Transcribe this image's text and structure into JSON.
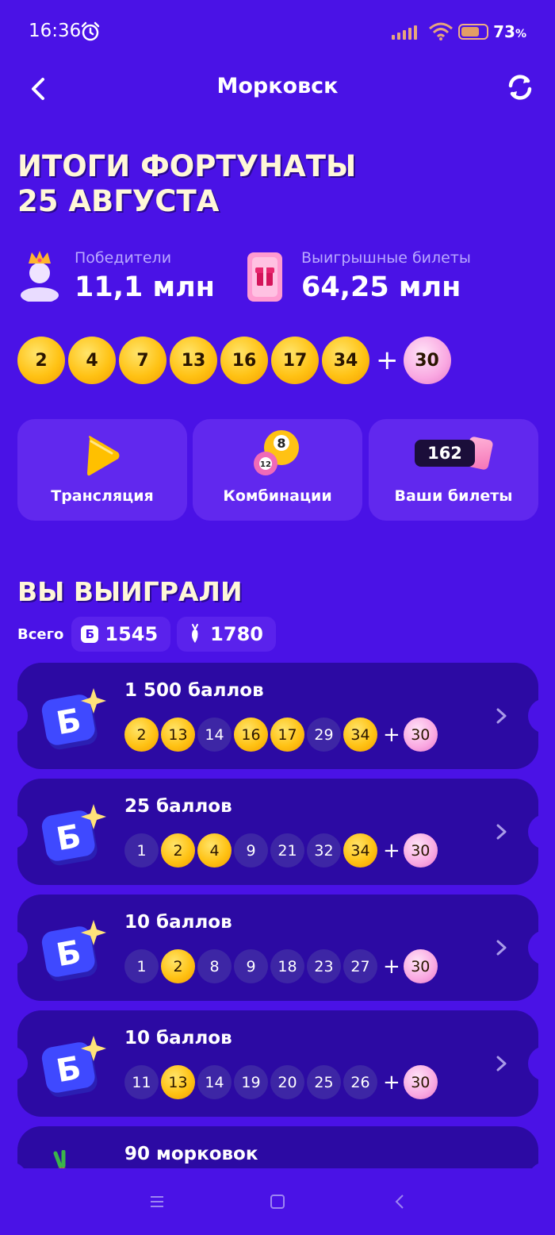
{
  "status": {
    "time": "16:36",
    "battery": "73",
    "battery_unit": "%"
  },
  "header": {
    "title": "Морковск"
  },
  "results": {
    "title_line1": "ИТОГИ ФОРТУНАТЫ",
    "title_line2": "25 АВГУСТА"
  },
  "stats": [
    {
      "label": "Победители",
      "value": "11,1 млн",
      "icon": "crown-person-icon"
    },
    {
      "label": "Выигрышные билеты",
      "value": "64,25 млн",
      "icon": "gift-ticket-icon"
    }
  ],
  "draw": {
    "numbers": [
      "2",
      "4",
      "7",
      "13",
      "16",
      "17",
      "34"
    ],
    "bonus": "30",
    "plus": "+"
  },
  "actions": [
    {
      "label": "Трансляция",
      "icon": "play-icon"
    },
    {
      "label": "Комбинации",
      "icon": "lottery-balls-icon"
    },
    {
      "label": "Ваши билеты",
      "icon": "ticket-icon",
      "count": "162"
    }
  ],
  "won": {
    "title": "ВЫ ВЫИГРАЛИ",
    "total_label": "Всего",
    "points_total": "1545",
    "points_icon_letter": "Б",
    "carrots_total": "1780"
  },
  "prizes": [
    {
      "title": "1 500 баллов",
      "balls": [
        {
          "n": "2",
          "hit": true
        },
        {
          "n": "13",
          "hit": true
        },
        {
          "n": "14",
          "hit": false
        },
        {
          "n": "16",
          "hit": true
        },
        {
          "n": "17",
          "hit": true
        },
        {
          "n": "29",
          "hit": false
        },
        {
          "n": "34",
          "hit": true
        }
      ],
      "bonus": "30"
    },
    {
      "title": "25 баллов",
      "balls": [
        {
          "n": "1",
          "hit": false
        },
        {
          "n": "2",
          "hit": true
        },
        {
          "n": "4",
          "hit": true
        },
        {
          "n": "9",
          "hit": false
        },
        {
          "n": "21",
          "hit": false
        },
        {
          "n": "32",
          "hit": false
        },
        {
          "n": "34",
          "hit": true
        }
      ],
      "bonus": "30"
    },
    {
      "title": "10 баллов",
      "balls": [
        {
          "n": "1",
          "hit": false
        },
        {
          "n": "2",
          "hit": true
        },
        {
          "n": "8",
          "hit": false
        },
        {
          "n": "9",
          "hit": false
        },
        {
          "n": "18",
          "hit": false
        },
        {
          "n": "23",
          "hit": false
        },
        {
          "n": "27",
          "hit": false
        }
      ],
      "bonus": "30"
    },
    {
      "title": "10 баллов",
      "balls": [
        {
          "n": "11",
          "hit": false
        },
        {
          "n": "13",
          "hit": true
        },
        {
          "n": "14",
          "hit": false
        },
        {
          "n": "19",
          "hit": false
        },
        {
          "n": "20",
          "hit": false
        },
        {
          "n": "25",
          "hit": false
        },
        {
          "n": "26",
          "hit": false
        }
      ],
      "bonus": "30"
    },
    {
      "title": "90 морковок",
      "balls": [],
      "bonus": ""
    }
  ],
  "colors": {
    "background": "#4a12e6",
    "card": "#2c0aa3",
    "gold": "#ffc214",
    "pink": "#f9a7e1",
    "title_yellow": "#fff7d8"
  }
}
